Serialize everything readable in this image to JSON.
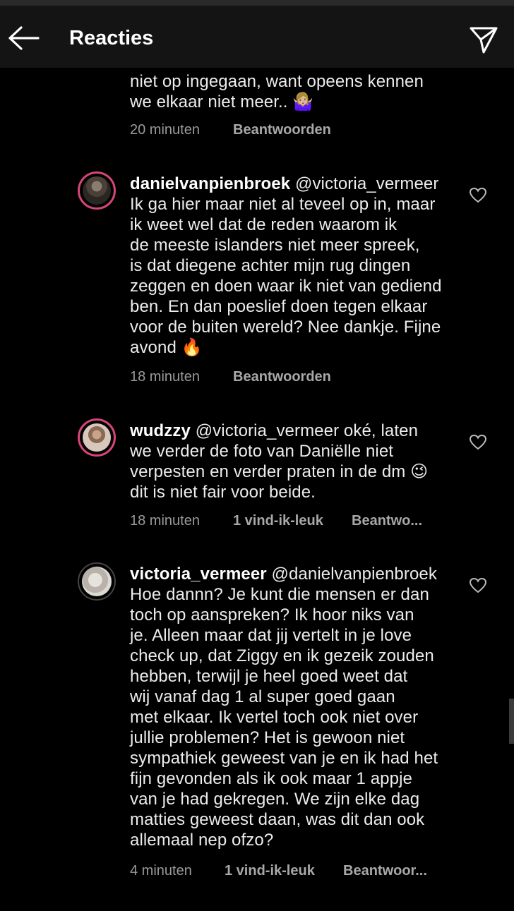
{
  "header": {
    "title": "Reacties"
  },
  "comments": [
    {
      "username": "",
      "mention": "",
      "lines": [
        "niet op ingegaan, want opeens kennen",
        "we elkaar niet meer.. 🤷🏼‍♀️"
      ],
      "time": "20 minuten",
      "likes": "",
      "reply": "Beantwoorden"
    },
    {
      "username": "danielvanpienbroek",
      "mention": "@victoria_vermeer",
      "lines": [
        "Ik ga hier maar niet al teveel op in, maar",
        "ik weet wel dat de reden waarom ik",
        "de meeste islanders niet meer spreek,",
        "is dat diegene achter mijn rug dingen",
        "zeggen en doen waar ik niet van gediend",
        "ben. En dan poeslief doen tegen elkaar",
        "voor de buiten wereld? Nee dankje. Fijne",
        "avond 🔥"
      ],
      "time": "18 minuten",
      "likes": "",
      "reply": "Beantwoorden"
    },
    {
      "username": "wudzzy",
      "mention": "@victoria_vermeer oké, laten",
      "lines": [
        "we verder de foto van Daniëlle niet",
        "verpesten en verder praten in de dm 😉",
        "dit is niet fair voor beide."
      ],
      "time": "18 minuten",
      "likes": "1 vind-ik-leuk",
      "reply": "Beantwo..."
    },
    {
      "username": "victoria_vermeer",
      "mention": "@danielvanpienbroek",
      "lines": [
        "Hoe dannn? Je kunt die mensen er dan",
        "toch op aanspreken? Ik hoor niks van",
        "je. Alleen maar dat jij vertelt in je love",
        "check up, dat Ziggy en ik gezeik zouden",
        "hebben, terwijl je heel goed weet dat",
        "wij vanaf dag 1 al super goed gaan",
        "met elkaar. Ik vertel toch ook niet over",
        "jullie problemen? Het is gewoon niet",
        "sympathiek geweest van je en ik had het",
        "fijn gevonden als ik ook maar 1 appje",
        "van je had gekregen. We zijn elke dag",
        "matties geweest daan, was dit dan ook",
        "allemaal nep ofzo?"
      ],
      "time": "4 minuten",
      "likes": "1 vind-ik-leuk",
      "reply": "Beantwoor..."
    }
  ]
}
